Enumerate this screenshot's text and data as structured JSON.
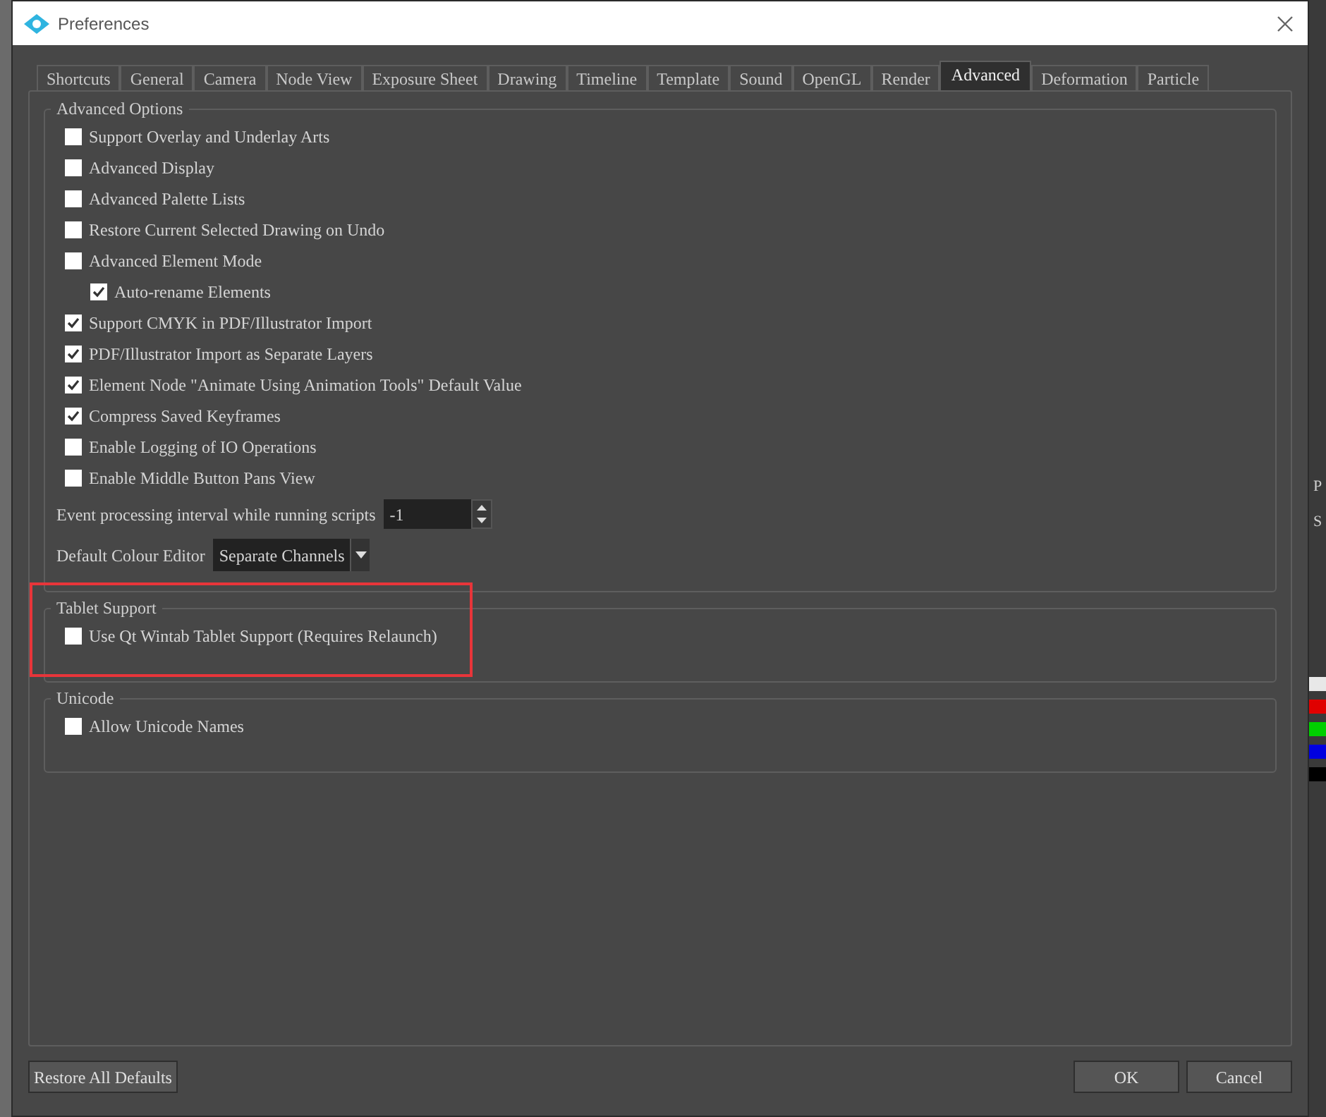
{
  "window": {
    "title": "Preferences"
  },
  "tabs": [
    {
      "label": "Shortcuts",
      "selected": false
    },
    {
      "label": "General",
      "selected": false
    },
    {
      "label": "Camera",
      "selected": false
    },
    {
      "label": "Node View",
      "selected": false
    },
    {
      "label": "Exposure Sheet",
      "selected": false
    },
    {
      "label": "Drawing",
      "selected": false
    },
    {
      "label": "Timeline",
      "selected": false
    },
    {
      "label": "Template",
      "selected": false
    },
    {
      "label": "Sound",
      "selected": false
    },
    {
      "label": "OpenGL",
      "selected": false
    },
    {
      "label": "Render",
      "selected": false
    },
    {
      "label": "Advanced",
      "selected": true
    },
    {
      "label": "Deformation",
      "selected": false
    },
    {
      "label": "Particle",
      "selected": false
    }
  ],
  "groups": [
    {
      "title": "Advanced Options",
      "highlighted": false,
      "items": [
        {
          "kind": "checkbox",
          "label": "Support Overlay and Underlay Arts",
          "checked": false
        },
        {
          "kind": "checkbox",
          "label": "Advanced Display",
          "checked": false
        },
        {
          "kind": "checkbox",
          "label": "Advanced Palette Lists",
          "checked": false
        },
        {
          "kind": "checkbox",
          "label": "Restore Current Selected Drawing on Undo",
          "checked": false
        },
        {
          "kind": "checkbox",
          "label": "Advanced Element Mode",
          "checked": false,
          "children": [
            {
              "kind": "checkbox",
              "label": "Auto-rename Elements",
              "checked": true
            }
          ]
        },
        {
          "kind": "checkbox",
          "label": "Support CMYK in PDF/Illustrator Import",
          "checked": true
        },
        {
          "kind": "checkbox",
          "label": "PDF/Illustrator Import as Separate Layers",
          "checked": true
        },
        {
          "kind": "checkbox",
          "label": "Element Node \"Animate Using Animation Tools\" Default Value",
          "checked": true
        },
        {
          "kind": "checkbox",
          "label": "Compress Saved Keyframes",
          "checked": true
        },
        {
          "kind": "checkbox",
          "label": "Enable Logging of IO Operations",
          "checked": false
        },
        {
          "kind": "checkbox",
          "label": "Enable Middle Button Pans View",
          "checked": false
        },
        {
          "kind": "spin",
          "label": "Event processing interval while running scripts",
          "value": "-1"
        },
        {
          "kind": "combo",
          "label": "Default Colour Editor",
          "value": "Separate Channels"
        }
      ]
    },
    {
      "title": "Tablet Support",
      "highlighted": true,
      "items": [
        {
          "kind": "checkbox",
          "label": "Use Qt Wintab Tablet Support (Requires Relaunch)",
          "checked": false
        }
      ]
    },
    {
      "title": "Unicode",
      "highlighted": false,
      "items": [
        {
          "kind": "checkbox",
          "label": "Allow Unicode Names",
          "checked": false
        }
      ]
    }
  ],
  "buttons": {
    "restore": "Restore All Defaults",
    "ok": "OK",
    "cancel": "Cancel"
  },
  "background_app": {
    "texts": [
      "P",
      "S"
    ]
  }
}
